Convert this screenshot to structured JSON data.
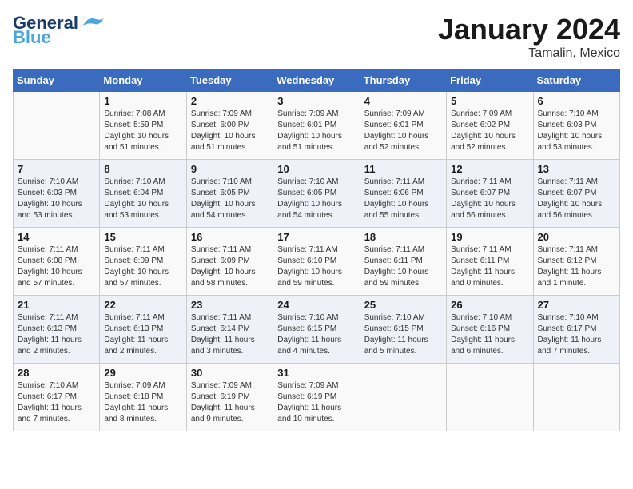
{
  "logo": {
    "text1": "General",
    "text2": "Blue"
  },
  "title": "January 2024",
  "location": "Tamalin, Mexico",
  "days_of_week": [
    "Sunday",
    "Monday",
    "Tuesday",
    "Wednesday",
    "Thursday",
    "Friday",
    "Saturday"
  ],
  "weeks": [
    [
      {
        "day": "",
        "info": ""
      },
      {
        "day": "1",
        "info": "Sunrise: 7:08 AM\nSunset: 5:59 PM\nDaylight: 10 hours\nand 51 minutes."
      },
      {
        "day": "2",
        "info": "Sunrise: 7:09 AM\nSunset: 6:00 PM\nDaylight: 10 hours\nand 51 minutes."
      },
      {
        "day": "3",
        "info": "Sunrise: 7:09 AM\nSunset: 6:01 PM\nDaylight: 10 hours\nand 51 minutes."
      },
      {
        "day": "4",
        "info": "Sunrise: 7:09 AM\nSunset: 6:01 PM\nDaylight: 10 hours\nand 52 minutes."
      },
      {
        "day": "5",
        "info": "Sunrise: 7:09 AM\nSunset: 6:02 PM\nDaylight: 10 hours\nand 52 minutes."
      },
      {
        "day": "6",
        "info": "Sunrise: 7:10 AM\nSunset: 6:03 PM\nDaylight: 10 hours\nand 53 minutes."
      }
    ],
    [
      {
        "day": "7",
        "info": "Sunrise: 7:10 AM\nSunset: 6:03 PM\nDaylight: 10 hours\nand 53 minutes."
      },
      {
        "day": "8",
        "info": "Sunrise: 7:10 AM\nSunset: 6:04 PM\nDaylight: 10 hours\nand 53 minutes."
      },
      {
        "day": "9",
        "info": "Sunrise: 7:10 AM\nSunset: 6:05 PM\nDaylight: 10 hours\nand 54 minutes."
      },
      {
        "day": "10",
        "info": "Sunrise: 7:10 AM\nSunset: 6:05 PM\nDaylight: 10 hours\nand 54 minutes."
      },
      {
        "day": "11",
        "info": "Sunrise: 7:11 AM\nSunset: 6:06 PM\nDaylight: 10 hours\nand 55 minutes."
      },
      {
        "day": "12",
        "info": "Sunrise: 7:11 AM\nSunset: 6:07 PM\nDaylight: 10 hours\nand 56 minutes."
      },
      {
        "day": "13",
        "info": "Sunrise: 7:11 AM\nSunset: 6:07 PM\nDaylight: 10 hours\nand 56 minutes."
      }
    ],
    [
      {
        "day": "14",
        "info": "Sunrise: 7:11 AM\nSunset: 6:08 PM\nDaylight: 10 hours\nand 57 minutes."
      },
      {
        "day": "15",
        "info": "Sunrise: 7:11 AM\nSunset: 6:09 PM\nDaylight: 10 hours\nand 57 minutes."
      },
      {
        "day": "16",
        "info": "Sunrise: 7:11 AM\nSunset: 6:09 PM\nDaylight: 10 hours\nand 58 minutes."
      },
      {
        "day": "17",
        "info": "Sunrise: 7:11 AM\nSunset: 6:10 PM\nDaylight: 10 hours\nand 59 minutes."
      },
      {
        "day": "18",
        "info": "Sunrise: 7:11 AM\nSunset: 6:11 PM\nDaylight: 10 hours\nand 59 minutes."
      },
      {
        "day": "19",
        "info": "Sunrise: 7:11 AM\nSunset: 6:11 PM\nDaylight: 11 hours\nand 0 minutes."
      },
      {
        "day": "20",
        "info": "Sunrise: 7:11 AM\nSunset: 6:12 PM\nDaylight: 11 hours\nand 1 minute."
      }
    ],
    [
      {
        "day": "21",
        "info": "Sunrise: 7:11 AM\nSunset: 6:13 PM\nDaylight: 11 hours\nand 2 minutes."
      },
      {
        "day": "22",
        "info": "Sunrise: 7:11 AM\nSunset: 6:13 PM\nDaylight: 11 hours\nand 2 minutes."
      },
      {
        "day": "23",
        "info": "Sunrise: 7:11 AM\nSunset: 6:14 PM\nDaylight: 11 hours\nand 3 minutes."
      },
      {
        "day": "24",
        "info": "Sunrise: 7:10 AM\nSunset: 6:15 PM\nDaylight: 11 hours\nand 4 minutes."
      },
      {
        "day": "25",
        "info": "Sunrise: 7:10 AM\nSunset: 6:15 PM\nDaylight: 11 hours\nand 5 minutes."
      },
      {
        "day": "26",
        "info": "Sunrise: 7:10 AM\nSunset: 6:16 PM\nDaylight: 11 hours\nand 6 minutes."
      },
      {
        "day": "27",
        "info": "Sunrise: 7:10 AM\nSunset: 6:17 PM\nDaylight: 11 hours\nand 7 minutes."
      }
    ],
    [
      {
        "day": "28",
        "info": "Sunrise: 7:10 AM\nSunset: 6:17 PM\nDaylight: 11 hours\nand 7 minutes."
      },
      {
        "day": "29",
        "info": "Sunrise: 7:09 AM\nSunset: 6:18 PM\nDaylight: 11 hours\nand 8 minutes."
      },
      {
        "day": "30",
        "info": "Sunrise: 7:09 AM\nSunset: 6:19 PM\nDaylight: 11 hours\nand 9 minutes."
      },
      {
        "day": "31",
        "info": "Sunrise: 7:09 AM\nSunset: 6:19 PM\nDaylight: 11 hours\nand 10 minutes."
      },
      {
        "day": "",
        "info": ""
      },
      {
        "day": "",
        "info": ""
      },
      {
        "day": "",
        "info": ""
      }
    ]
  ]
}
